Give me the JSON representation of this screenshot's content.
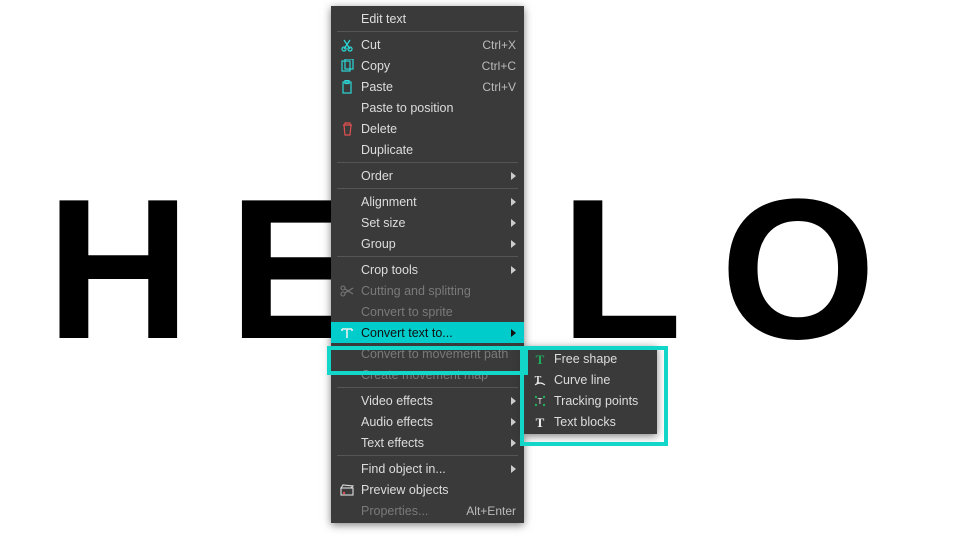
{
  "canvas": {
    "text": "HELLO"
  },
  "menu": {
    "edit_text": "Edit text",
    "cut": "Cut",
    "cut_sc": "Ctrl+X",
    "copy": "Copy",
    "copy_sc": "Ctrl+C",
    "paste": "Paste",
    "paste_sc": "Ctrl+V",
    "paste_pos": "Paste to position",
    "delete": "Delete",
    "duplicate": "Duplicate",
    "order": "Order",
    "alignment": "Alignment",
    "set_size": "Set size",
    "group": "Group",
    "crop_tools": "Crop tools",
    "cutting": "Cutting and splitting",
    "conv_sprite": "Convert to sprite",
    "conv_text": "Convert text to...",
    "conv_mpath": "Convert to movement path",
    "create_mmap": "Create movement map",
    "video_fx": "Video effects",
    "audio_fx": "Audio effects",
    "text_fx": "Text effects",
    "find_obj": "Find object in...",
    "preview": "Preview objects",
    "properties": "Properties...",
    "properties_sc": "Alt+Enter"
  },
  "submenu": {
    "free_shape": "Free shape",
    "curve_line": "Curve line",
    "tracking_pts": "Tracking points",
    "text_blocks": "Text blocks"
  },
  "icons": {
    "cut": "cut-icon",
    "copy": "copy-icon",
    "paste": "paste-icon",
    "delete": "trash-icon",
    "cutting": "scissors-icon",
    "conv_text": "text-t-icon",
    "preview": "clapper-icon",
    "free_shape": "bold-t-icon",
    "curve_line": "t-curve-icon",
    "tracking_pts": "tracking-icon",
    "text_blocks": "t-blocks-icon"
  },
  "colors": {
    "accent": "#12d6c8",
    "menu_bg": "#3a3a3a"
  }
}
